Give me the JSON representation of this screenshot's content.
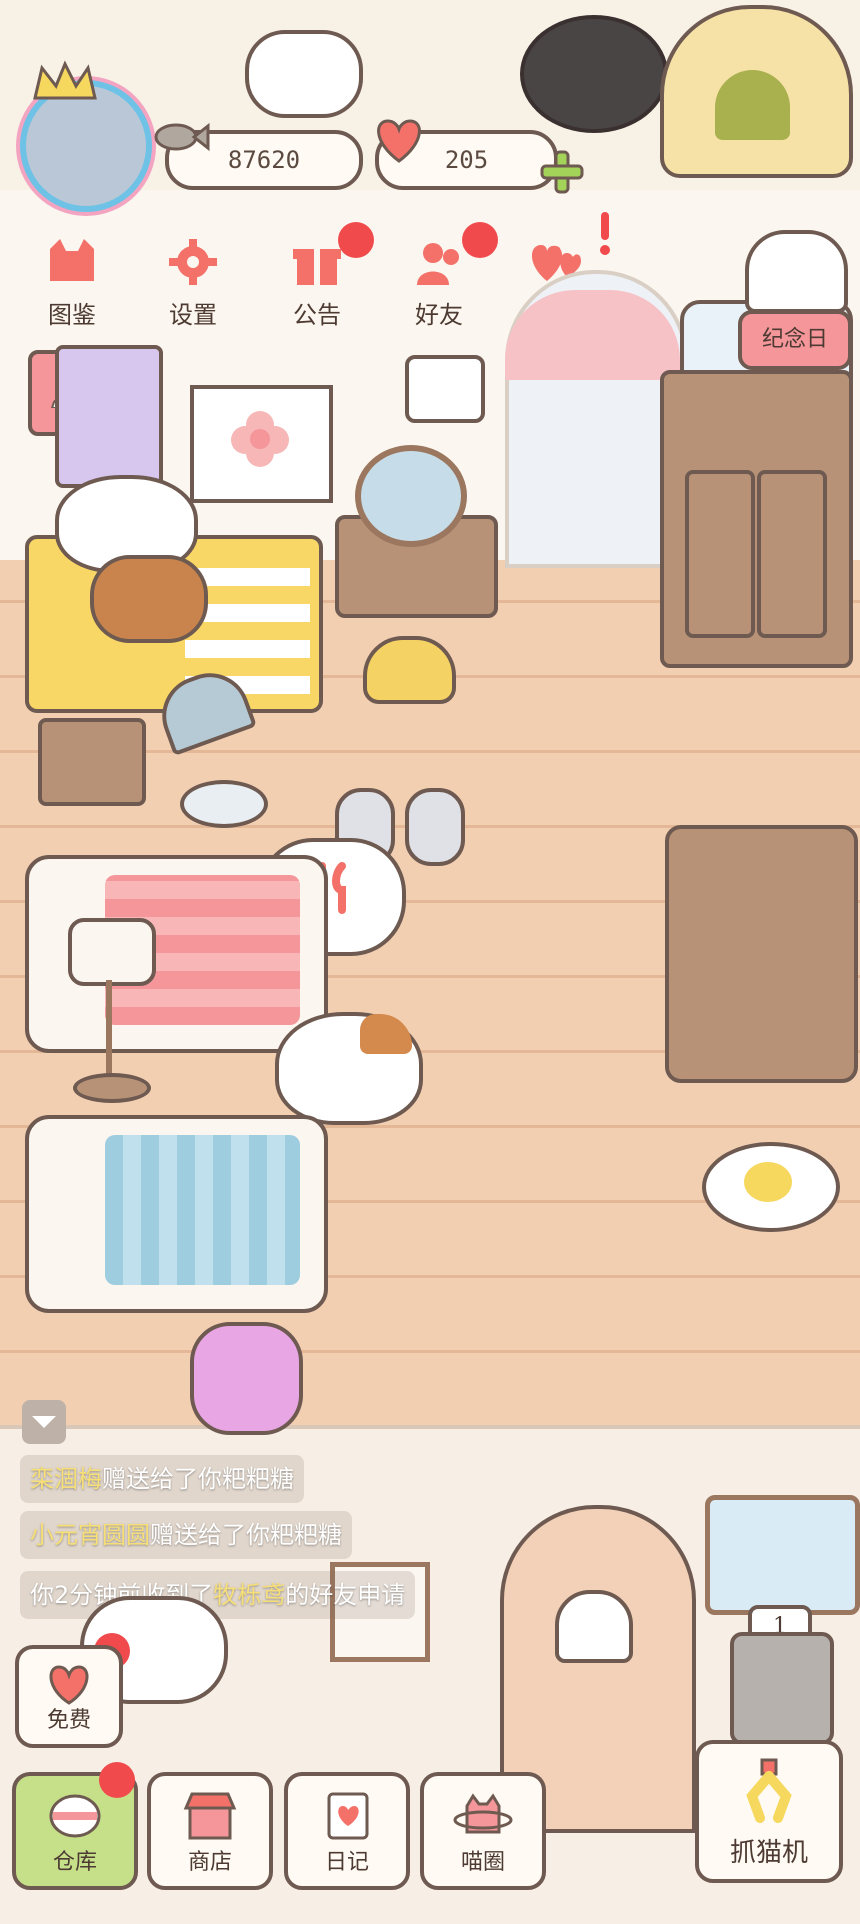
{
  "hud": {
    "coins": "87620",
    "hearts": "205"
  },
  "menu": [
    {
      "label": "图鉴",
      "icon": "cat-book-icon"
    },
    {
      "label": "设置",
      "icon": "gear-icon"
    },
    {
      "label": "公告",
      "icon": "gift-icon"
    },
    {
      "label": "好友",
      "icon": "friends-icon"
    },
    {
      "label": "",
      "icon": "hearts-icon"
    }
  ],
  "anniversary": {
    "label": "纪念日"
  },
  "chat": [
    {
      "name": "栾涸梅",
      "text": "赠送给了你粑粑糖"
    },
    {
      "name": "小元宵圆圆",
      "text": "赠送给了你粑粑糖"
    },
    {
      "pre": "你2分钟前收到了",
      "name": "牧栎鸢",
      "post": "的好友申请"
    }
  ],
  "bottom": {
    "free": "免费",
    "warehouse": "仓库",
    "shop": "商店",
    "diary": "日记",
    "meow_circle": "喵圈",
    "claw_machine": "抓猫机",
    "claw_count": "1"
  },
  "colors": {
    "accent": "#f4716a",
    "outline": "#6e5a50",
    "floor": "#f3cfb2",
    "badge_red": "#f14a4d",
    "highlight_name": "#f7df78"
  }
}
